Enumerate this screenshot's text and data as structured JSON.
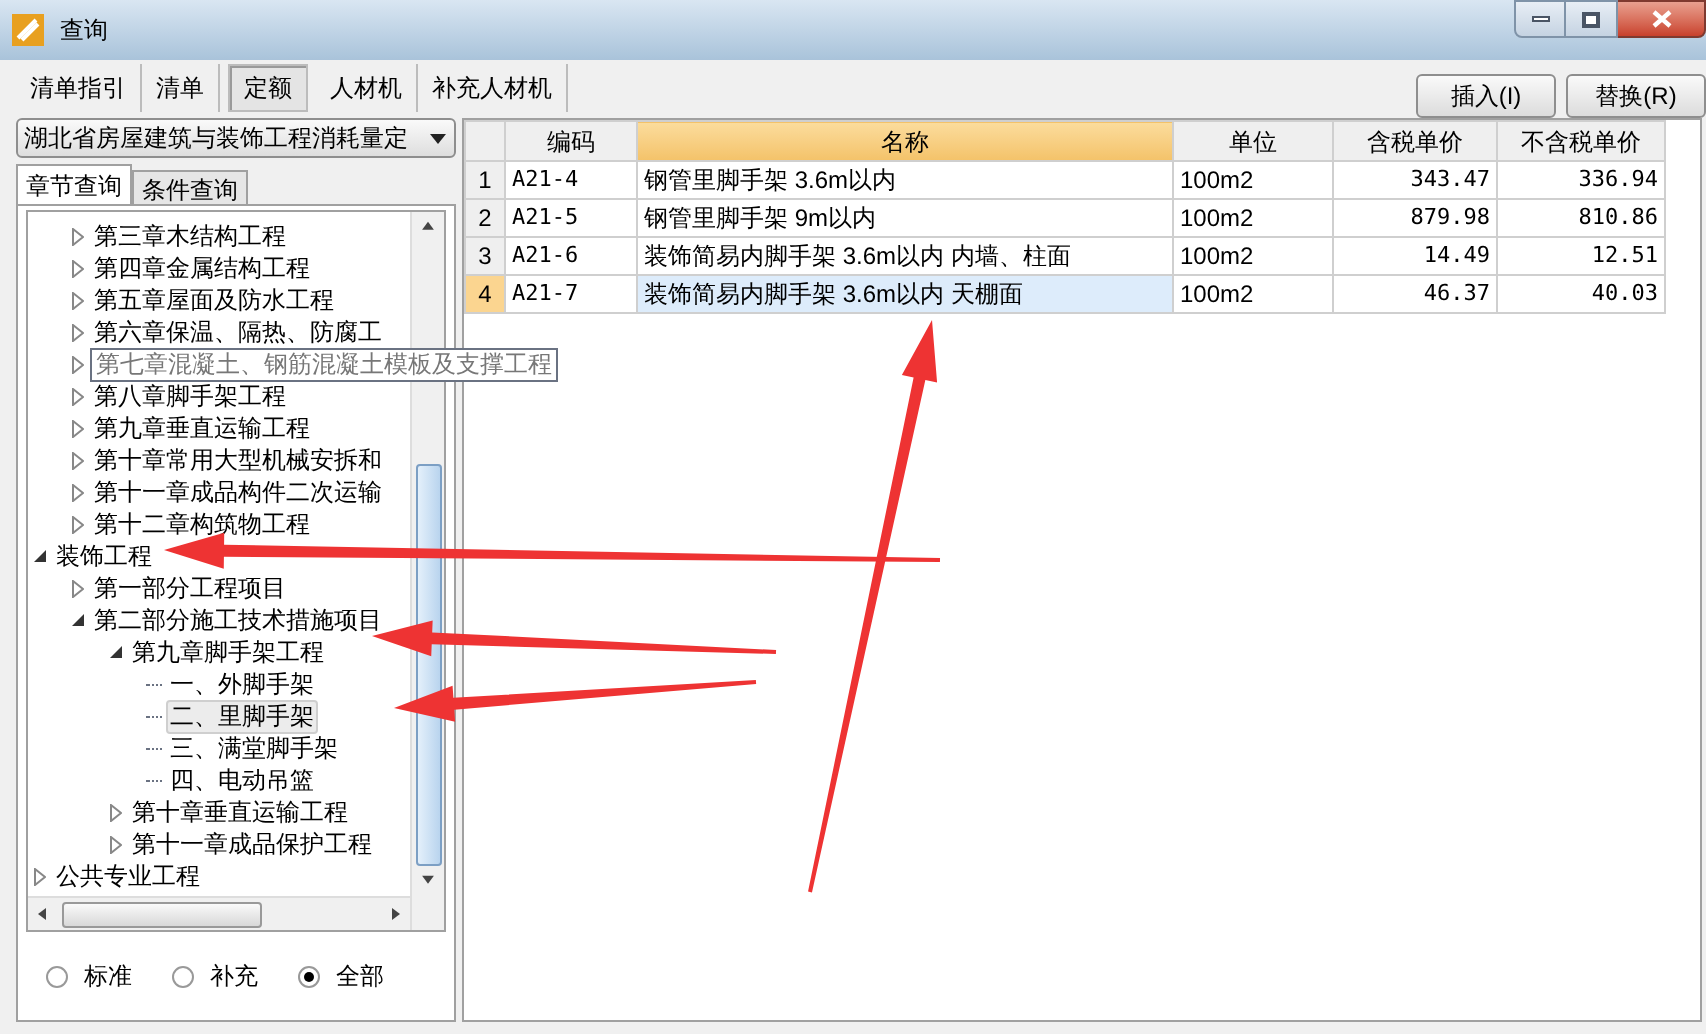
{
  "window": {
    "title": "查询"
  },
  "tabs": [
    {
      "label": "清单指引",
      "selected": false
    },
    {
      "label": "清单",
      "selected": false
    },
    {
      "label": "定额",
      "selected": true
    },
    {
      "label": "人材机",
      "selected": false
    },
    {
      "label": "补充人材机",
      "selected": false
    }
  ],
  "buttons": [
    "插入(I)",
    "替换(R)"
  ],
  "library_select": {
    "value": "湖北省房屋建筑与装饰工程消耗量定"
  },
  "sub_tabs": [
    {
      "label": "章节查询",
      "selected": true
    },
    {
      "label": "条件查询",
      "selected": false
    }
  ],
  "tree": [
    {
      "children": [
        {
          "label": "第三章木结构工程",
          "expanded": false,
          "selected": false,
          "hovered": false
        },
        {
          "label": "第四章金属结构工程",
          "expanded": false,
          "selected": false,
          "hovered": false
        },
        {
          "label": "第五章屋面及防水工程",
          "expanded": false,
          "selected": false,
          "hovered": false
        },
        {
          "label": "第六章保温、隔热、防腐工",
          "expanded": false,
          "selected": false,
          "hovered": false
        },
        {
          "label": "第七章混凝土、钢筋混凝土模板及支撑工程",
          "expanded": false,
          "selected": false,
          "hovered": true
        },
        {
          "label": "第八章脚手架工程",
          "expanded": false,
          "selected": false,
          "hovered": false
        },
        {
          "label": "第九章垂直运输工程",
          "expanded": false,
          "selected": false,
          "hovered": false
        },
        {
          "label": "第十章常用大型机械安拆和",
          "expanded": false,
          "selected": false,
          "hovered": false
        },
        {
          "label": "第十一章成品构件二次运输",
          "expanded": false,
          "selected": false,
          "hovered": false
        },
        {
          "label": "第十二章构筑物工程",
          "expanded": false,
          "selected": false,
          "hovered": false
        }
      ]
    },
    {
      "label": "装饰工程",
      "expanded": true,
      "selected": false,
      "hovered": false,
      "children": [
        {
          "label": "第一部分工程项目",
          "expanded": false,
          "selected": false,
          "hovered": false
        },
        {
          "label": "第二部分施工技术措施项目",
          "expanded": true,
          "selected": false,
          "hovered": false,
          "children": [
            {
              "label": "第九章脚手架工程",
              "expanded": true,
              "selected": false,
              "hovered": false,
              "children": [
                {
                  "label": "一、外脚手架",
                  "selected": false,
                  "hovered": false
                },
                {
                  "label": "二、里脚手架",
                  "selected": true,
                  "hovered": false
                },
                {
                  "label": "三、满堂脚手架",
                  "selected": false,
                  "hovered": false
                },
                {
                  "label": "四、电动吊篮",
                  "selected": false,
                  "hovered": false
                }
              ]
            },
            {
              "label": "第十章垂直运输工程",
              "expanded": false,
              "selected": false,
              "hovered": false
            },
            {
              "label": "第十一章成品保护工程",
              "expanded": false,
              "selected": false,
              "hovered": false
            }
          ]
        }
      ]
    },
    {
      "label": "公共专业工程",
      "expanded": false,
      "selected": false,
      "hovered": false
    }
  ],
  "filter": [
    {
      "label": "标准",
      "selected": false
    },
    {
      "label": "补充",
      "selected": false
    },
    {
      "label": "全部",
      "selected": true
    }
  ],
  "table": {
    "columns": [
      "编码",
      "名称",
      "单位",
      "含税单价",
      "不含税单价"
    ],
    "rows": [
      {
        "index": "1",
        "cells": [
          "A21-4",
          "钢管里脚手架 3.6m以内",
          "100m2",
          "343.47",
          "336.94"
        ],
        "selected": false
      },
      {
        "index": "2",
        "cells": [
          "A21-5",
          "钢管里脚手架 9m以内",
          "100m2",
          "879.98",
          "810.86"
        ],
        "selected": false
      },
      {
        "index": "3",
        "cells": [
          "A21-6",
          "装饰简易内脚手架 3.6m以内 内墙、柱面",
          "100m2",
          "14.49",
          "12.51"
        ],
        "selected": false
      },
      {
        "index": "4",
        "cells": [
          "A21-7",
          "装饰简易内脚手架 3.6m以内 天棚面",
          "100m2",
          "46.37",
          "40.03"
        ],
        "selected": true
      }
    ]
  }
}
